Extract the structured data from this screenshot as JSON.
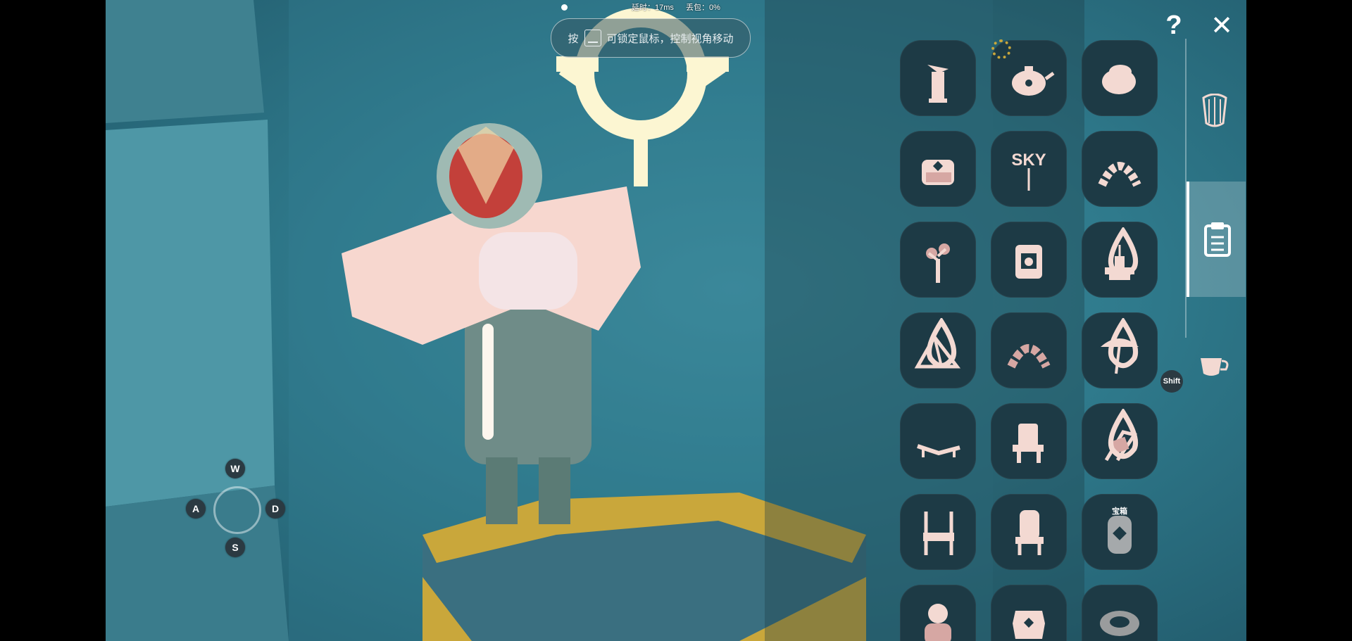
{
  "hud": {
    "latency": "延时：17ms",
    "packet_loss": "丢包：0%",
    "lock_prefix": "按",
    "lock_text": "可锁定鼠标，控制视角移动"
  },
  "controls": {
    "w": "W",
    "a": "A",
    "s": "S",
    "d": "D",
    "shift": "Shift"
  },
  "top_buttons": {
    "help": "?",
    "close": "✕"
  },
  "grid_items": [
    {
      "name": "bird-totem-icon",
      "drop": false
    },
    {
      "name": "teapot-icon",
      "drop": false
    },
    {
      "name": "bread-oven-icon",
      "drop": false
    },
    {
      "name": "armchair-icon",
      "drop": false
    },
    {
      "name": "sky-balloons-icon",
      "drop": false
    },
    {
      "name": "balloon-arch-icon",
      "drop": false
    },
    {
      "name": "tree-icon",
      "drop": false
    },
    {
      "name": "fireplace-icon",
      "drop": false
    },
    {
      "name": "flower-table-icon",
      "drop": true
    },
    {
      "name": "tent-icon",
      "drop": true
    },
    {
      "name": "flower-arch-icon",
      "drop": false
    },
    {
      "name": "parasol-icon",
      "drop": true
    },
    {
      "name": "lounge-chair-icon",
      "drop": false
    },
    {
      "name": "adirondack-chair-icon",
      "drop": false
    },
    {
      "name": "deck-chair-icon",
      "drop": true
    },
    {
      "name": "bamboo-chair-icon",
      "drop": false
    },
    {
      "name": "highback-chair-icon",
      "drop": false
    },
    {
      "name": "shrine-icon",
      "drop": false,
      "label": "宝箱"
    },
    {
      "name": "snowman-icon",
      "drop": false
    },
    {
      "name": "lantern-icon",
      "drop": false
    },
    {
      "name": "bowl-icon",
      "drop": false
    }
  ],
  "side_tabs": [
    "harp-icon",
    "notepad-icon",
    "teacup-icon"
  ],
  "colors": {
    "icon": "#f3d9d2",
    "slot": "#1d3a45",
    "accent_gold": "#c9a73b"
  }
}
